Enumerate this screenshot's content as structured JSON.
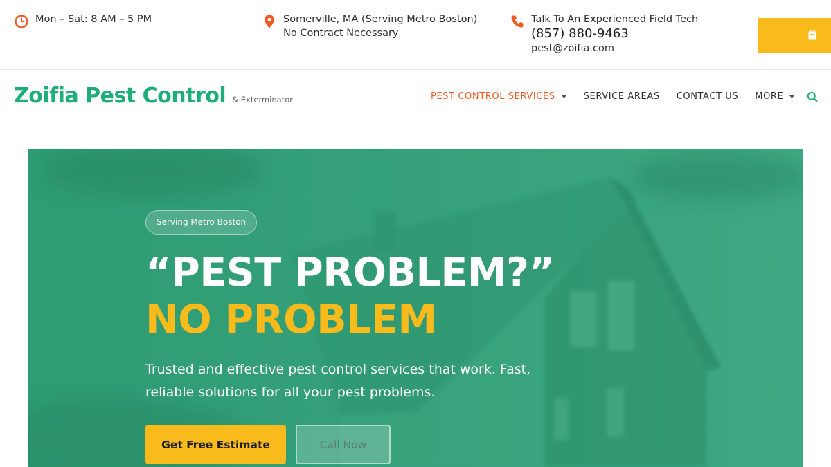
{
  "topbar": {
    "hours": "Mon – Sat: 8 AM – 5 PM",
    "location_line1": "Somerville, MA (Serving Metro Boston)",
    "location_line2": "No Contract Necessary",
    "phone_label": "Talk To An Experienced Field Tech",
    "phone_number": "(857) 880-9463",
    "email": "pest@zoifia.com",
    "quote_icon": "calendar-icon"
  },
  "brand": {
    "name": "Zoifia Pest Control",
    "tagline": "& Exterminator"
  },
  "nav": {
    "items": [
      {
        "label": "PEST CONTROL SERVICES",
        "active": true,
        "dropdown": true
      },
      {
        "label": "SERVICE AREAS",
        "active": false,
        "dropdown": false
      },
      {
        "label": "CONTACT US",
        "active": false,
        "dropdown": false
      },
      {
        "label": "MORE",
        "active": false,
        "dropdown": true
      }
    ],
    "search_icon": "search-icon"
  },
  "hero": {
    "badge": "Serving Metro Boston",
    "title_line1": "“PEST PROBLEM?”",
    "title_line2": "NO PROBLEM",
    "description": "Trusted and effective pest control services that work. Fast, reliable solutions for all your pest problems.",
    "primary_button": "Get Free Estimate",
    "secondary_button": "Call Now"
  },
  "colors": {
    "brand_green": "#1fae7a",
    "accent_orange": "#ef5a24",
    "accent_yellow": "#f9bb1b",
    "hero_green": "#35a07a"
  }
}
